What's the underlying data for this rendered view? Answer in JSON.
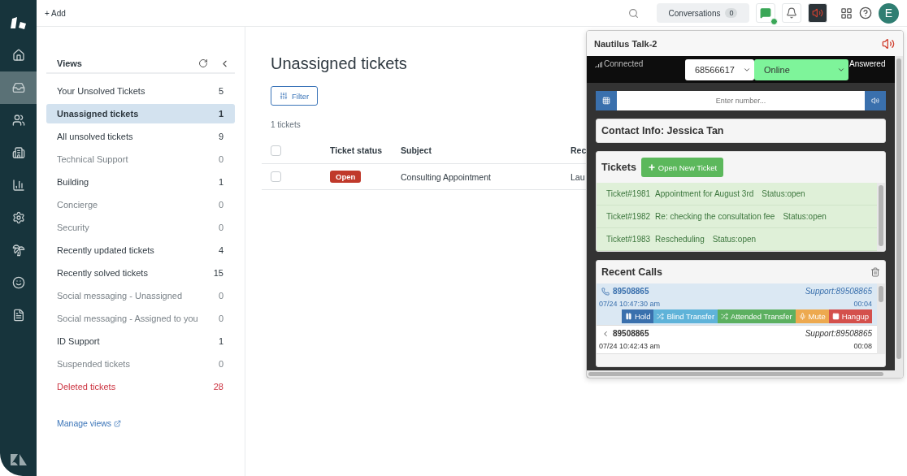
{
  "topbar": {
    "add_label": "+ Add",
    "conversations": {
      "label": "Conversations",
      "count": "0"
    },
    "chat_online": true,
    "avatar": "E"
  },
  "views": {
    "title": "Views",
    "items": [
      {
        "label": "Your Unsolved Tickets",
        "count": "5",
        "kind": "default",
        "selected": false
      },
      {
        "label": "Unassigned tickets",
        "count": "1",
        "kind": "default",
        "selected": true
      },
      {
        "label": "All unsolved tickets",
        "count": "9",
        "kind": "default",
        "selected": false
      },
      {
        "label": "Technical Support",
        "count": "0",
        "kind": "muted",
        "selected": false
      },
      {
        "label": "Building",
        "count": "1",
        "kind": "default",
        "selected": false
      },
      {
        "label": "Concierge",
        "count": "0",
        "kind": "muted",
        "selected": false
      },
      {
        "label": "Security",
        "count": "0",
        "kind": "muted",
        "selected": false
      },
      {
        "label": "Recently updated tickets",
        "count": "4",
        "kind": "default",
        "selected": false
      },
      {
        "label": "Recently solved tickets",
        "count": "15",
        "kind": "default",
        "selected": false
      },
      {
        "label": "Social messaging - Unassigned",
        "count": "0",
        "kind": "muted",
        "selected": false
      },
      {
        "label": "Social messaging - Assigned to you",
        "count": "0",
        "kind": "muted",
        "selected": false
      },
      {
        "label": "ID Support",
        "count": "1",
        "kind": "default",
        "selected": false
      },
      {
        "label": "Suspended tickets",
        "count": "0",
        "kind": "muted",
        "selected": false
      },
      {
        "label": "Deleted tickets",
        "count": "28",
        "kind": "danger",
        "selected": false
      }
    ],
    "manage_link": "Manage views"
  },
  "main": {
    "title": "Unassigned tickets",
    "filter_button": "Filter",
    "count_text": "1 tickets",
    "table": {
      "all_checked": false,
      "columns": [
        "Ticket status",
        "Subject",
        "Rec"
      ],
      "rows": [
        {
          "checked": false,
          "status": "Open",
          "subject": "Consulting Appointment",
          "column_4": "Lau"
        }
      ]
    }
  },
  "phone": {
    "title": "Nautilus Talk-2",
    "connection": "Connected",
    "line": "68566617",
    "status": "Online",
    "call_state": "Answered",
    "number_placeholder": "Enter number...",
    "contact": "Contact Info: Jessica Tan",
    "tickets_title": "Tickets",
    "new_ticket_button": "Open New Ticket",
    "tickets": [
      {
        "id": "Ticket#1981",
        "subject": "Appointment for August 3rd",
        "status": "Status:open"
      },
      {
        "id": "Ticket#1982",
        "subject": "Re: checking the consultation fee",
        "status": "Status:open"
      },
      {
        "id": "Ticket#1983",
        "subject": "Rescheduling",
        "status": "Status:open"
      }
    ],
    "recent_title": "Recent Calls",
    "calls": [
      {
        "kind": "phone",
        "selected": true,
        "number": "89508865",
        "queue": "Support:89508865",
        "time": "07/24 10:47:30 am",
        "duration": "00:04",
        "actions": [
          {
            "kind": "hold",
            "label": "Hold",
            "color": "#3a70ad"
          },
          {
            "kind": "blind",
            "label": "Blind Transfer",
            "color": "#5fb3d9"
          },
          {
            "kind": "attended",
            "label": "Attended Transfer",
            "color": "#5cb060"
          },
          {
            "kind": "mute",
            "label": "Mute",
            "color": "#eda94f"
          },
          {
            "kind": "hangup",
            "label": "Hangup",
            "color": "#d4504c"
          }
        ]
      },
      {
        "kind": "back",
        "selected": false,
        "number": "89508865",
        "queue": "Support:89508865",
        "time": "07/24 10:42:43 am",
        "duration": "00:08"
      }
    ]
  }
}
